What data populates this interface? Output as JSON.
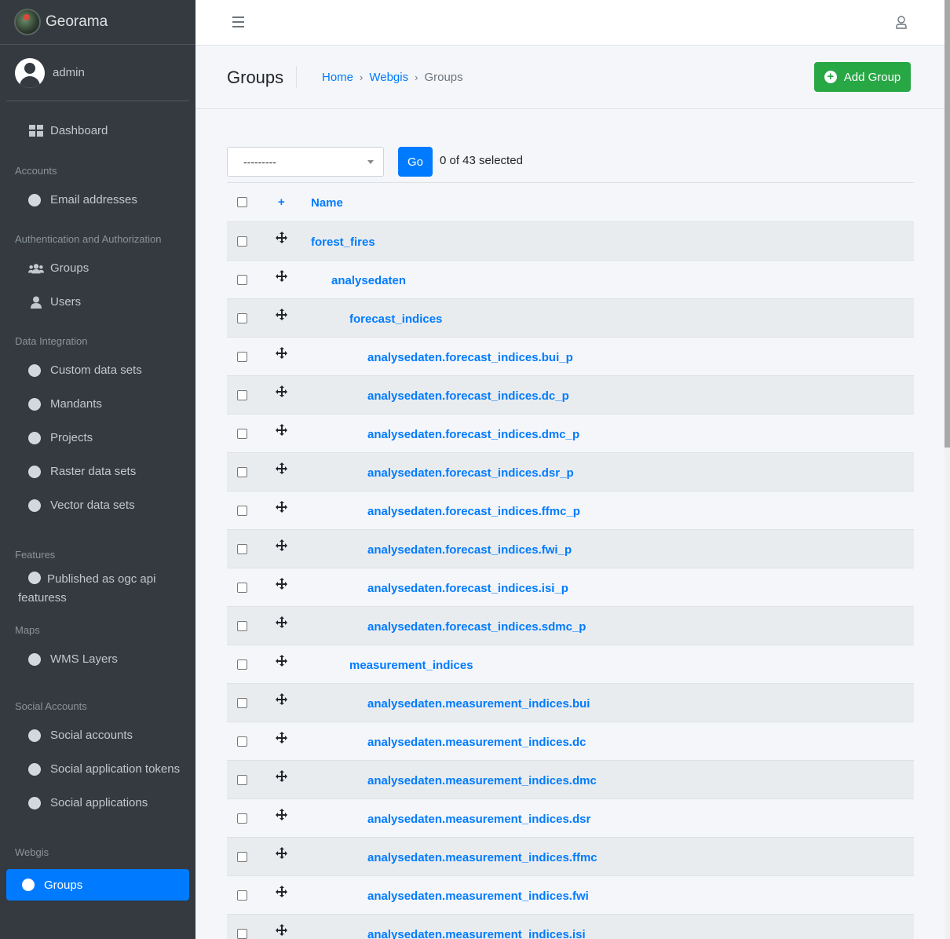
{
  "brand": {
    "name": "Georama"
  },
  "user": {
    "name": "admin"
  },
  "sidebar": {
    "dashboard": "Dashboard",
    "sections": [
      {
        "header": "Accounts",
        "items": [
          "Email addresses"
        ]
      },
      {
        "header": "Authentication and Authorization",
        "items": [
          "Groups",
          "Users"
        ]
      },
      {
        "header": "Data Integration",
        "items": [
          "Custom data sets",
          "Mandants",
          "Projects",
          "Raster data sets",
          "Vector data sets"
        ]
      },
      {
        "header": "Features",
        "items": [
          "Published as ogc api featuress"
        ]
      },
      {
        "header": "Maps",
        "items": [
          "WMS Layers"
        ]
      },
      {
        "header": "Social Accounts",
        "items": [
          "Social accounts",
          "Social application tokens",
          "Social applications"
        ]
      },
      {
        "header": "Webgis",
        "items": [
          "Groups"
        ]
      }
    ],
    "active_item": "Groups"
  },
  "header": {
    "title": "Groups",
    "breadcrumb": [
      "Home",
      "Webgis",
      "Groups"
    ],
    "add_button": "Add Group"
  },
  "actions": {
    "select_value": "---------",
    "go_label": "Go",
    "selected_text": "0 of 43 selected"
  },
  "table": {
    "plus_header": "+",
    "name_header": "Name",
    "rows": [
      {
        "name": "forest_fires",
        "level": 0
      },
      {
        "name": "analysedaten",
        "level": 1
      },
      {
        "name": "forecast_indices",
        "level": 2
      },
      {
        "name": "analysedaten.forecast_indices.bui_p",
        "level": 3
      },
      {
        "name": "analysedaten.forecast_indices.dc_p",
        "level": 3
      },
      {
        "name": "analysedaten.forecast_indices.dmc_p",
        "level": 3
      },
      {
        "name": "analysedaten.forecast_indices.dsr_p",
        "level": 3
      },
      {
        "name": "analysedaten.forecast_indices.ffmc_p",
        "level": 3
      },
      {
        "name": "analysedaten.forecast_indices.fwi_p",
        "level": 3
      },
      {
        "name": "analysedaten.forecast_indices.isi_p",
        "level": 3
      },
      {
        "name": "analysedaten.forecast_indices.sdmc_p",
        "level": 3
      },
      {
        "name": "measurement_indices",
        "level": 2
      },
      {
        "name": "analysedaten.measurement_indices.bui",
        "level": 3
      },
      {
        "name": "analysedaten.measurement_indices.dc",
        "level": 3
      },
      {
        "name": "analysedaten.measurement_indices.dmc",
        "level": 3
      },
      {
        "name": "analysedaten.measurement_indices.dsr",
        "level": 3
      },
      {
        "name": "analysedaten.measurement_indices.ffmc",
        "level": 3
      },
      {
        "name": "analysedaten.measurement_indices.fwi",
        "level": 3
      },
      {
        "name": "analysedaten.measurement_indices.isi",
        "level": 3
      }
    ]
  },
  "colors": {
    "primary": "#007bff",
    "success": "#28a745",
    "sidebar": "#343a40"
  }
}
